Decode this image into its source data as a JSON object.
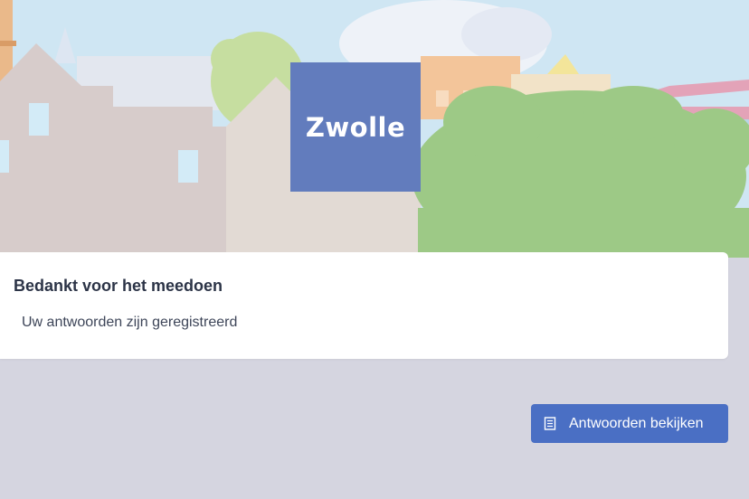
{
  "hero": {
    "logo_text": "Zwolle"
  },
  "card": {
    "title": "Bedankt voor het meedoen",
    "subtitle": "Uw antwoorden zijn geregistreerd"
  },
  "actions": {
    "view_answers_label": "Antwoorden bekijken",
    "view_answers_icon": "document-icon"
  },
  "colors": {
    "logo_bg": "#627cbd",
    "button_bg": "#4a6fc4",
    "page_bg": "#d5d5e0"
  }
}
